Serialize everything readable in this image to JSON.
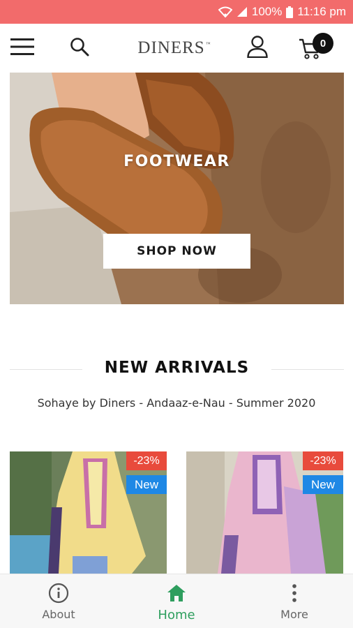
{
  "status_bar": {
    "battery": "100%",
    "time": "11:16 pm",
    "icons": [
      "wifi-icon",
      "signal-icon",
      "battery-icon"
    ]
  },
  "header": {
    "logo": "DINERS",
    "logo_mark": "™",
    "cart_count": "0",
    "icons": [
      "menu-icon",
      "search-icon",
      "user-icon",
      "cart-icon"
    ]
  },
  "banner": {
    "title": "FOOTWEAR",
    "button_label": "SHOP NOW"
  },
  "new_arrivals": {
    "title": "NEW ARRIVALS",
    "subtitle": "Sohaye by Diners - Andaaz-e-Nau - Summer 2020",
    "products": [
      {
        "discount": "-23%",
        "badge": "New"
      },
      {
        "discount": "-23%",
        "badge": "New"
      }
    ]
  },
  "bottom_nav": {
    "items": [
      {
        "label": "About",
        "icon": "info-icon"
      },
      {
        "label": "Home",
        "icon": "home-icon",
        "active": true
      },
      {
        "label": "More",
        "icon": "more-vertical-icon"
      }
    ]
  },
  "colors": {
    "status_bar": "#f26b6b",
    "active_nav": "#2e9e5e",
    "discount_badge": "#e84b3c",
    "new_badge": "#1e88e5"
  }
}
